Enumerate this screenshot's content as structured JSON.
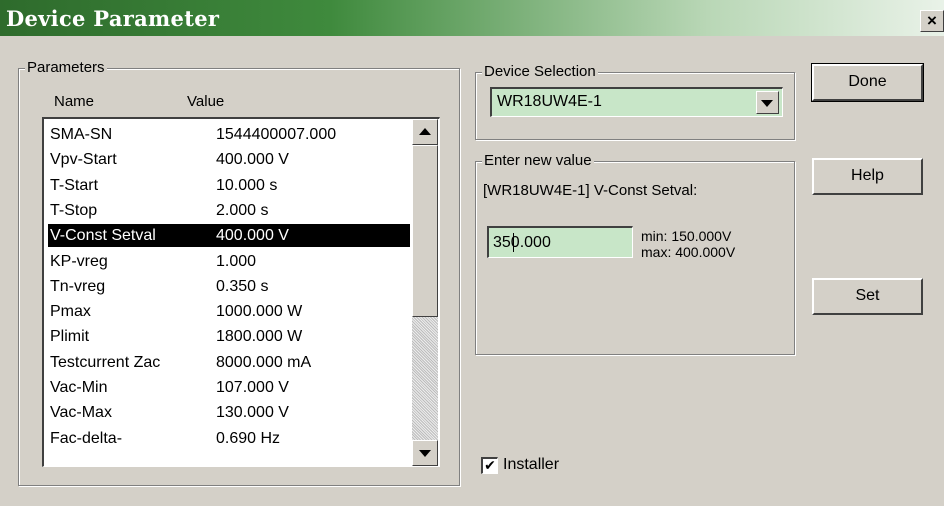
{
  "window": {
    "title": "Device Parameter"
  },
  "parameters": {
    "group_label": "Parameters",
    "col_name": "Name",
    "col_value": "Value",
    "rows": [
      {
        "name": "SMA-SN",
        "value": "1544400007.000"
      },
      {
        "name": "Vpv-Start",
        "value": "400.000 V"
      },
      {
        "name": "T-Start",
        "value": "10.000 s"
      },
      {
        "name": "T-Stop",
        "value": "2.000 s"
      },
      {
        "name": "V-Const Setval",
        "value": "400.000 V"
      },
      {
        "name": "KP-vreg",
        "value": "1.000"
      },
      {
        "name": "Tn-vreg",
        "value": "0.350 s"
      },
      {
        "name": "Pmax",
        "value": "1000.000 W"
      },
      {
        "name": "Plimit",
        "value": "1800.000 W"
      },
      {
        "name": "Testcurrent Zac",
        "value": "8000.000 mA"
      },
      {
        "name": "Vac-Min",
        "value": "107.000 V"
      },
      {
        "name": "Vac-Max",
        "value": "130.000 V"
      },
      {
        "name": "Fac-delta-",
        "value": "0.690 Hz"
      }
    ],
    "selected_index": 4
  },
  "device_selection": {
    "group_label": "Device Selection",
    "selected": "WR18UW4E-1"
  },
  "enter_value": {
    "group_label": "Enter new value",
    "prompt": "[WR18UW4E-1] V-Const Setval:",
    "input_value": "350.000",
    "min_text": "min: 150.000V",
    "max_text": "max: 400.000V"
  },
  "buttons": {
    "done": "Done",
    "help": "Help",
    "set": "Set"
  },
  "installer": {
    "label": "Installer",
    "checked": true,
    "check_glyph": "✔"
  },
  "icons": {
    "close": "×",
    "scroll_up": "triangle-up",
    "scroll_down": "triangle-down",
    "dropdown": "triangle-down"
  },
  "colors": {
    "title_bar": "#2e6b2c",
    "field_bg": "#c8e6c8",
    "dialog_bg": "#d4d0c8",
    "selection_bg": "#000000"
  }
}
